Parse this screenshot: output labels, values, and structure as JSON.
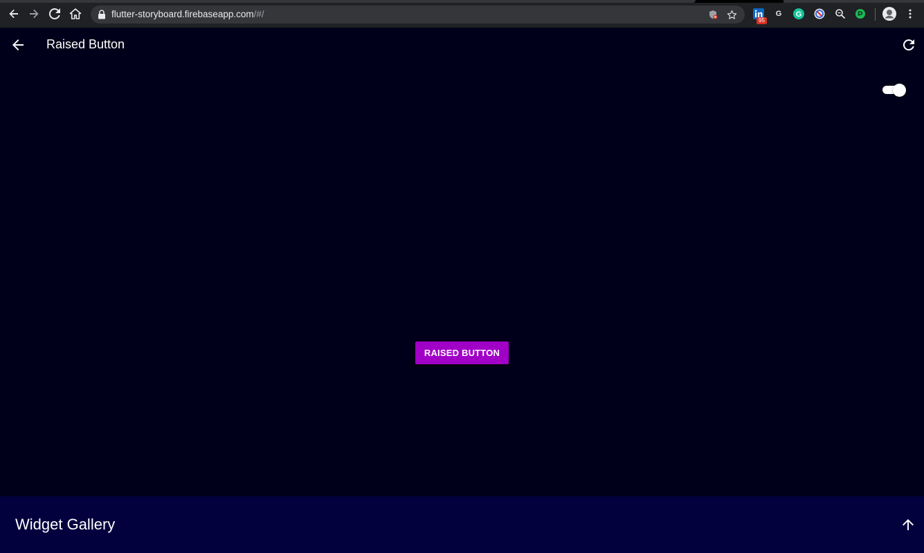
{
  "browser": {
    "url_host": "flutter-storyboard.firebaseapp.com",
    "url_path": "/#/",
    "extensions": [
      {
        "name": "linkedin-extension-icon",
        "badge": "95"
      },
      {
        "name": "g-extension-icon",
        "letter": "G"
      },
      {
        "name": "grammarly-icon",
        "letter": "G"
      },
      {
        "name": "circle-slash-extension-icon"
      },
      {
        "name": "zoom-extension-icon"
      },
      {
        "name": "green-extension-icon"
      }
    ]
  },
  "app_bar": {
    "title": "Raised Button"
  },
  "main": {
    "switch_on": true,
    "raised_button_label": "RAISED BUTTON"
  },
  "bottom_panel": {
    "title": "Widget Gallery"
  },
  "colors": {
    "background": "#00001a",
    "button": "#a100c6",
    "bottom_panel": "#02003d",
    "browser_bar": "#202124"
  }
}
